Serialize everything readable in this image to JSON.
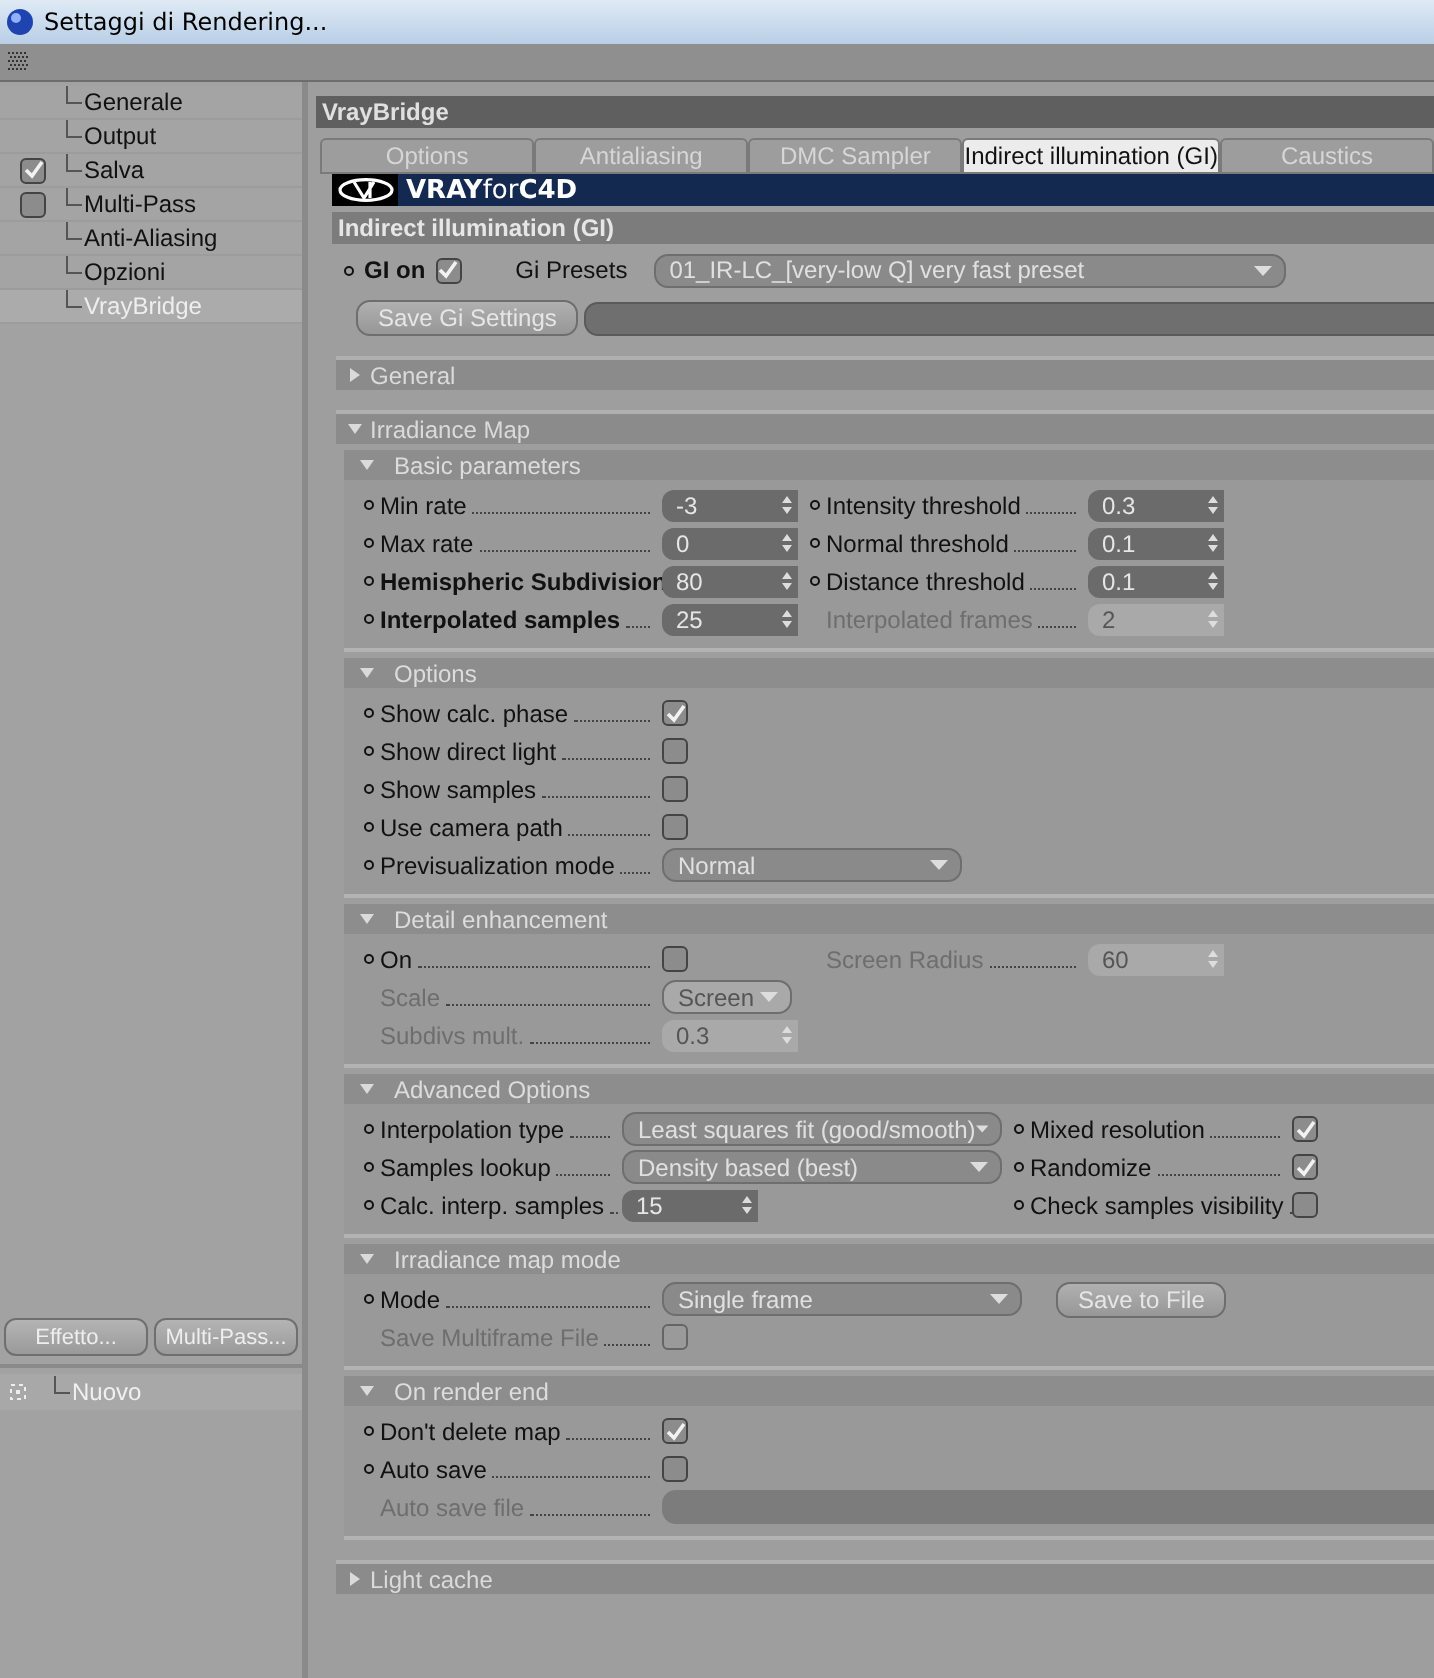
{
  "window": {
    "title": "Settaggi di Rendering..."
  },
  "sidebar": {
    "items": [
      {
        "label": "Generale",
        "kind": "plain",
        "selected": false
      },
      {
        "label": "Output",
        "kind": "plain",
        "selected": false
      },
      {
        "label": "Salva",
        "kind": "checkbox",
        "checked": true,
        "selected": false
      },
      {
        "label": "Multi-Pass",
        "kind": "checkbox",
        "checked": false,
        "selected": false
      },
      {
        "label": "Anti-Aliasing",
        "kind": "plain",
        "selected": false
      },
      {
        "label": "Opzioni",
        "kind": "plain",
        "selected": false
      },
      {
        "label": "VrayBridge",
        "kind": "plain",
        "selected": true
      }
    ],
    "buttons": [
      "Effetto...",
      "Multi-Pass..."
    ],
    "effects": [
      {
        "label": "Nuovo"
      }
    ]
  },
  "panel": {
    "title": "VrayBridge",
    "tabs": [
      {
        "label": "Options",
        "selected": false
      },
      {
        "label": "Antialiasing",
        "selected": false
      },
      {
        "label": "DMC Sampler",
        "selected": false
      },
      {
        "label": "Indirect illumination (GI)",
        "selected": true
      },
      {
        "label": "Caustics",
        "selected": false
      }
    ],
    "logo": "**VRAY**for**C4D**",
    "section_title": "Indirect illumination (GI)",
    "gi_on": {
      "label": "GI on",
      "checked": true
    },
    "presets": {
      "label": "Gi Presets",
      "value": "01_IR-LC_[very-low Q] very fast preset"
    },
    "save_button": "Save Gi Settings",
    "groups": [
      {
        "title": "General",
        "expanded": false
      },
      {
        "title": "Irradiance Map",
        "expanded": true,
        "subsections": [
          {
            "title": "Basic parameters",
            "columns": [
              [
                {
                  "kind": "number",
                  "label": "Min rate",
                  "value": "-3",
                  "bold": false,
                  "disabled": false
                },
                {
                  "kind": "number",
                  "label": "Max rate",
                  "value": "0",
                  "bold": false,
                  "disabled": false
                },
                {
                  "kind": "number",
                  "label": "Hemispheric Subdivision",
                  "value": "80",
                  "bold": true,
                  "disabled": false
                },
                {
                  "kind": "number",
                  "label": "Interpolated samples",
                  "value": "25",
                  "bold": true,
                  "disabled": false
                }
              ],
              [
                {
                  "kind": "number",
                  "label": "Intensity threshold",
                  "value": "0.3",
                  "bold": false,
                  "disabled": false
                },
                {
                  "kind": "number",
                  "label": "Normal threshold",
                  "value": "0.1",
                  "bold": false,
                  "disabled": false
                },
                {
                  "kind": "number",
                  "label": "Distance threshold",
                  "value": "0.1",
                  "bold": false,
                  "disabled": false
                },
                {
                  "kind": "number",
                  "label": "Interpolated frames",
                  "value": "2",
                  "bold": false,
                  "disabled": true
                }
              ]
            ]
          },
          {
            "title": "Options",
            "columns": [
              [
                {
                  "kind": "checkbox",
                  "label": "Show calc. phase",
                  "checked": true,
                  "disabled": false
                },
                {
                  "kind": "checkbox",
                  "label": "Show direct light",
                  "checked": false,
                  "disabled": false
                },
                {
                  "kind": "checkbox",
                  "label": "Show samples",
                  "checked": false,
                  "disabled": false
                },
                {
                  "kind": "checkbox",
                  "label": "Use camera path",
                  "checked": false,
                  "disabled": false
                },
                {
                  "kind": "dropdown",
                  "label": "Previsualization mode",
                  "value": "Normal",
                  "disabled": false
                }
              ]
            ]
          },
          {
            "title": "Detail enhancement",
            "columns": [
              [
                {
                  "kind": "checkbox",
                  "label": "On",
                  "checked": false,
                  "disabled": false
                },
                {
                  "kind": "dropdown",
                  "label": "Scale",
                  "value": "Screen",
                  "disabled": true
                },
                {
                  "kind": "number",
                  "label": "Subdivs mult.",
                  "value": "0.3",
                  "bold": false,
                  "disabled": true
                }
              ],
              [
                {
                  "kind": "number",
                  "label": "Screen Radius",
                  "value": "60",
                  "bold": false,
                  "disabled": true
                }
              ]
            ]
          },
          {
            "title": "Advanced Options",
            "columns": [
              [
                {
                  "kind": "dropdown",
                  "label": "Interpolation type",
                  "value": "Least squares fit (good/smooth)",
                  "disabled": false
                },
                {
                  "kind": "dropdown",
                  "label": "Samples lookup",
                  "value": "Density based (best)",
                  "disabled": false
                },
                {
                  "kind": "number",
                  "label": "Calc. interp. samples",
                  "value": "15",
                  "bold": false,
                  "disabled": false
                }
              ],
              [
                {
                  "kind": "checkbox",
                  "label": "Mixed resolution",
                  "checked": true,
                  "disabled": false
                },
                {
                  "kind": "checkbox",
                  "label": "Randomize",
                  "checked": true,
                  "disabled": false
                },
                {
                  "kind": "checkbox",
                  "label": "Check samples visibility",
                  "checked": false,
                  "disabled": false
                }
              ]
            ]
          },
          {
            "title": "Irradiance map mode",
            "columns": [
              [
                {
                  "kind": "dropdown",
                  "label": "Mode",
                  "value": "Single frame",
                  "disabled": false,
                  "button": "Save to File"
                },
                {
                  "kind": "checkbox",
                  "label": "Save Multiframe File",
                  "checked": false,
                  "disabled": true
                }
              ]
            ]
          },
          {
            "title": "On render end",
            "columns": [
              [
                {
                  "kind": "checkbox",
                  "label": "Don't delete map",
                  "checked": true,
                  "disabled": false
                },
                {
                  "kind": "checkbox",
                  "label": "Auto save",
                  "checked": false,
                  "disabled": false
                },
                {
                  "kind": "field",
                  "label": "Auto save file",
                  "disabled": true
                }
              ]
            ]
          }
        ]
      },
      {
        "title": "Light cache",
        "expanded": false
      }
    ]
  }
}
